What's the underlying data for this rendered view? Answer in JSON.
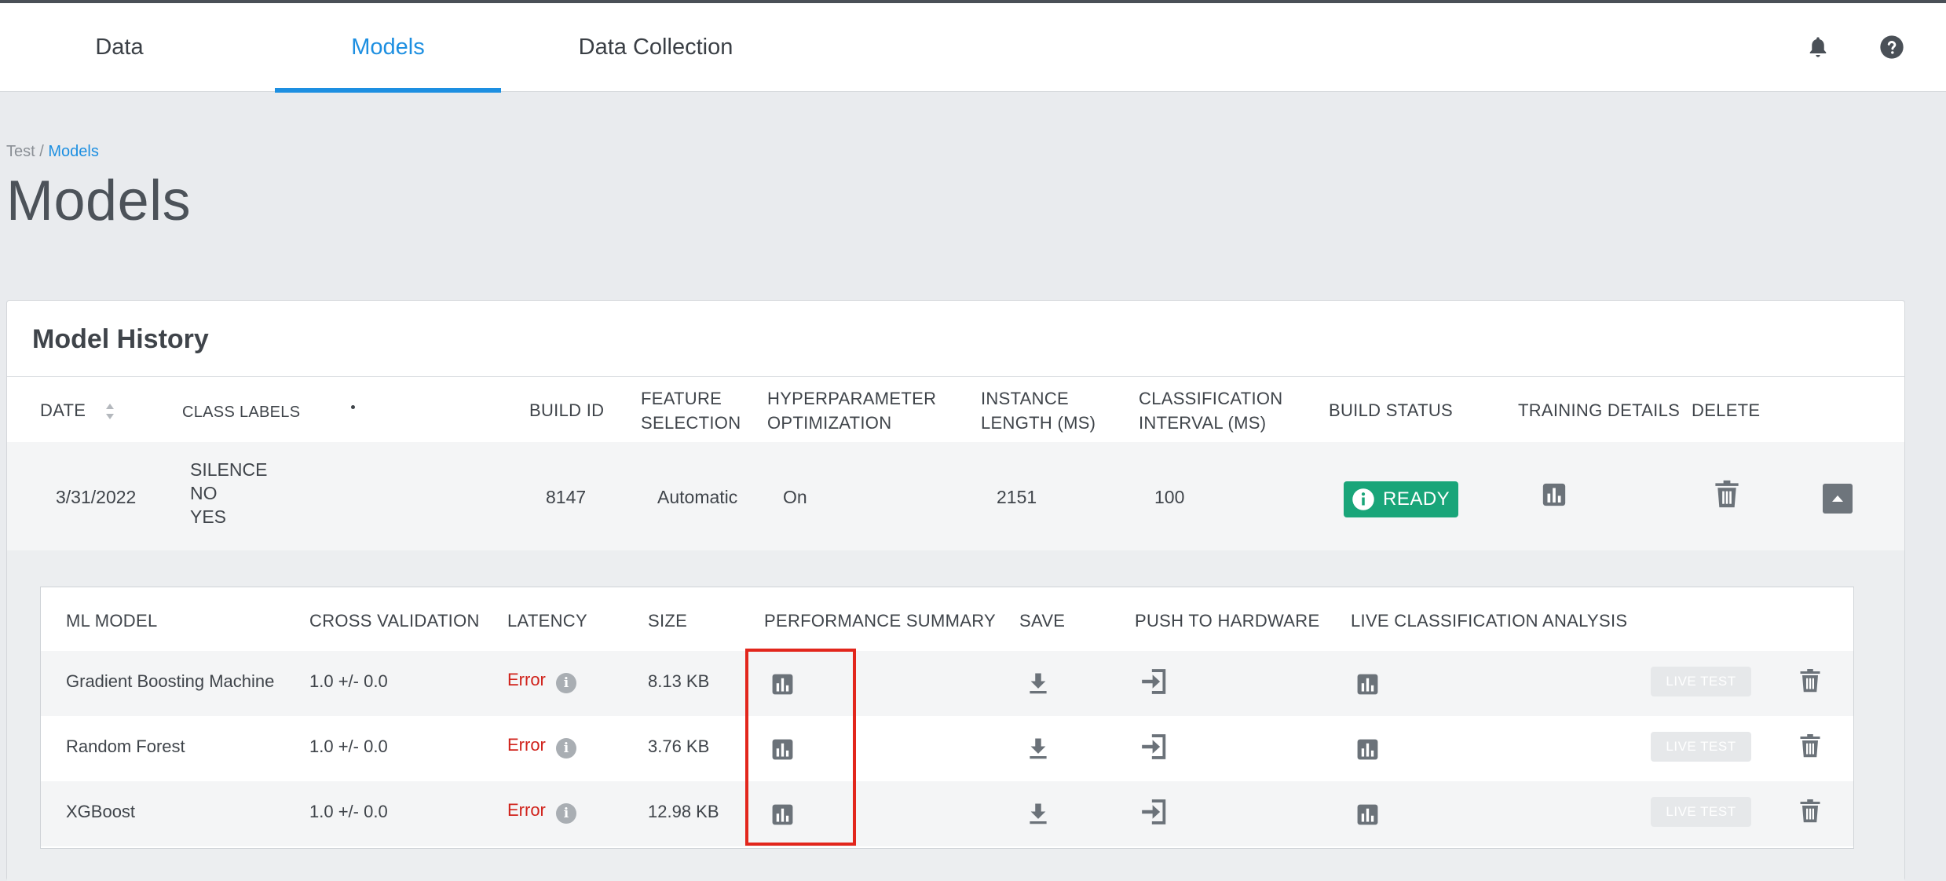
{
  "nav": {
    "tabs": [
      {
        "label": "Data"
      },
      {
        "label": "Models"
      },
      {
        "label": "Data Collection"
      }
    ],
    "active_tab": "Models",
    "icons": [
      "bell-icon",
      "help-icon"
    ]
  },
  "breadcrumb": {
    "parent": "Test",
    "separator": " / ",
    "current": "Models"
  },
  "page_title": "Models",
  "model_history": {
    "title": "Model History",
    "headers": {
      "date": "DATE",
      "class_labels": "CLASS LABELS",
      "build_id": "BUILD ID",
      "feature_selection": [
        "FEATURE",
        "SELECTION"
      ],
      "hyperparameter": [
        "HYPERPARAMETER",
        "OPTIMIZATION"
      ],
      "instance_length": [
        "INSTANCE",
        "LENGTH (MS)"
      ],
      "classification_interval": [
        "CLASSIFICATION",
        "INTERVAL (MS)"
      ],
      "build_status": "BUILD STATUS",
      "training_details": "TRAINING DETAILS",
      "delete": "DELETE"
    },
    "row": {
      "date": "3/31/2022",
      "class_labels": [
        "SILENCE",
        "NO",
        "YES"
      ],
      "build_id": "8147",
      "feature_selection": "Automatic",
      "hyperparameter": "On",
      "instance_length": "2151",
      "classification_interval": "100",
      "status": "READY"
    }
  },
  "ml_models": {
    "headers": {
      "ml_model": "ML MODEL",
      "cross_validation": "CROSS VALIDATION",
      "latency": "LATENCY",
      "size": "SIZE",
      "performance_summary": "PERFORMANCE SUMMARY",
      "save": "SAVE",
      "push_to_hardware": "PUSH TO HARDWARE",
      "live_classification": "LIVE CLASSIFICATION ANALYSIS"
    },
    "rows": [
      {
        "name": "Gradient Boosting Machine",
        "cv": "1.0 +/- 0.0",
        "latency": "Error",
        "size": "8.13 KB",
        "live": "LIVE TEST"
      },
      {
        "name": "Random Forest",
        "cv": "1.0 +/- 0.0",
        "latency": "Error",
        "size": "3.76 KB",
        "live": "LIVE TEST"
      },
      {
        "name": "XGBoost",
        "cv": "1.0 +/- 0.0",
        "latency": "Error",
        "size": "12.98 KB",
        "live": "LIVE TEST"
      }
    ]
  },
  "colors": {
    "accent": "#1d8fe1",
    "ready": "#19a579",
    "error": "#d0221b",
    "highlight": "#e2261c"
  }
}
